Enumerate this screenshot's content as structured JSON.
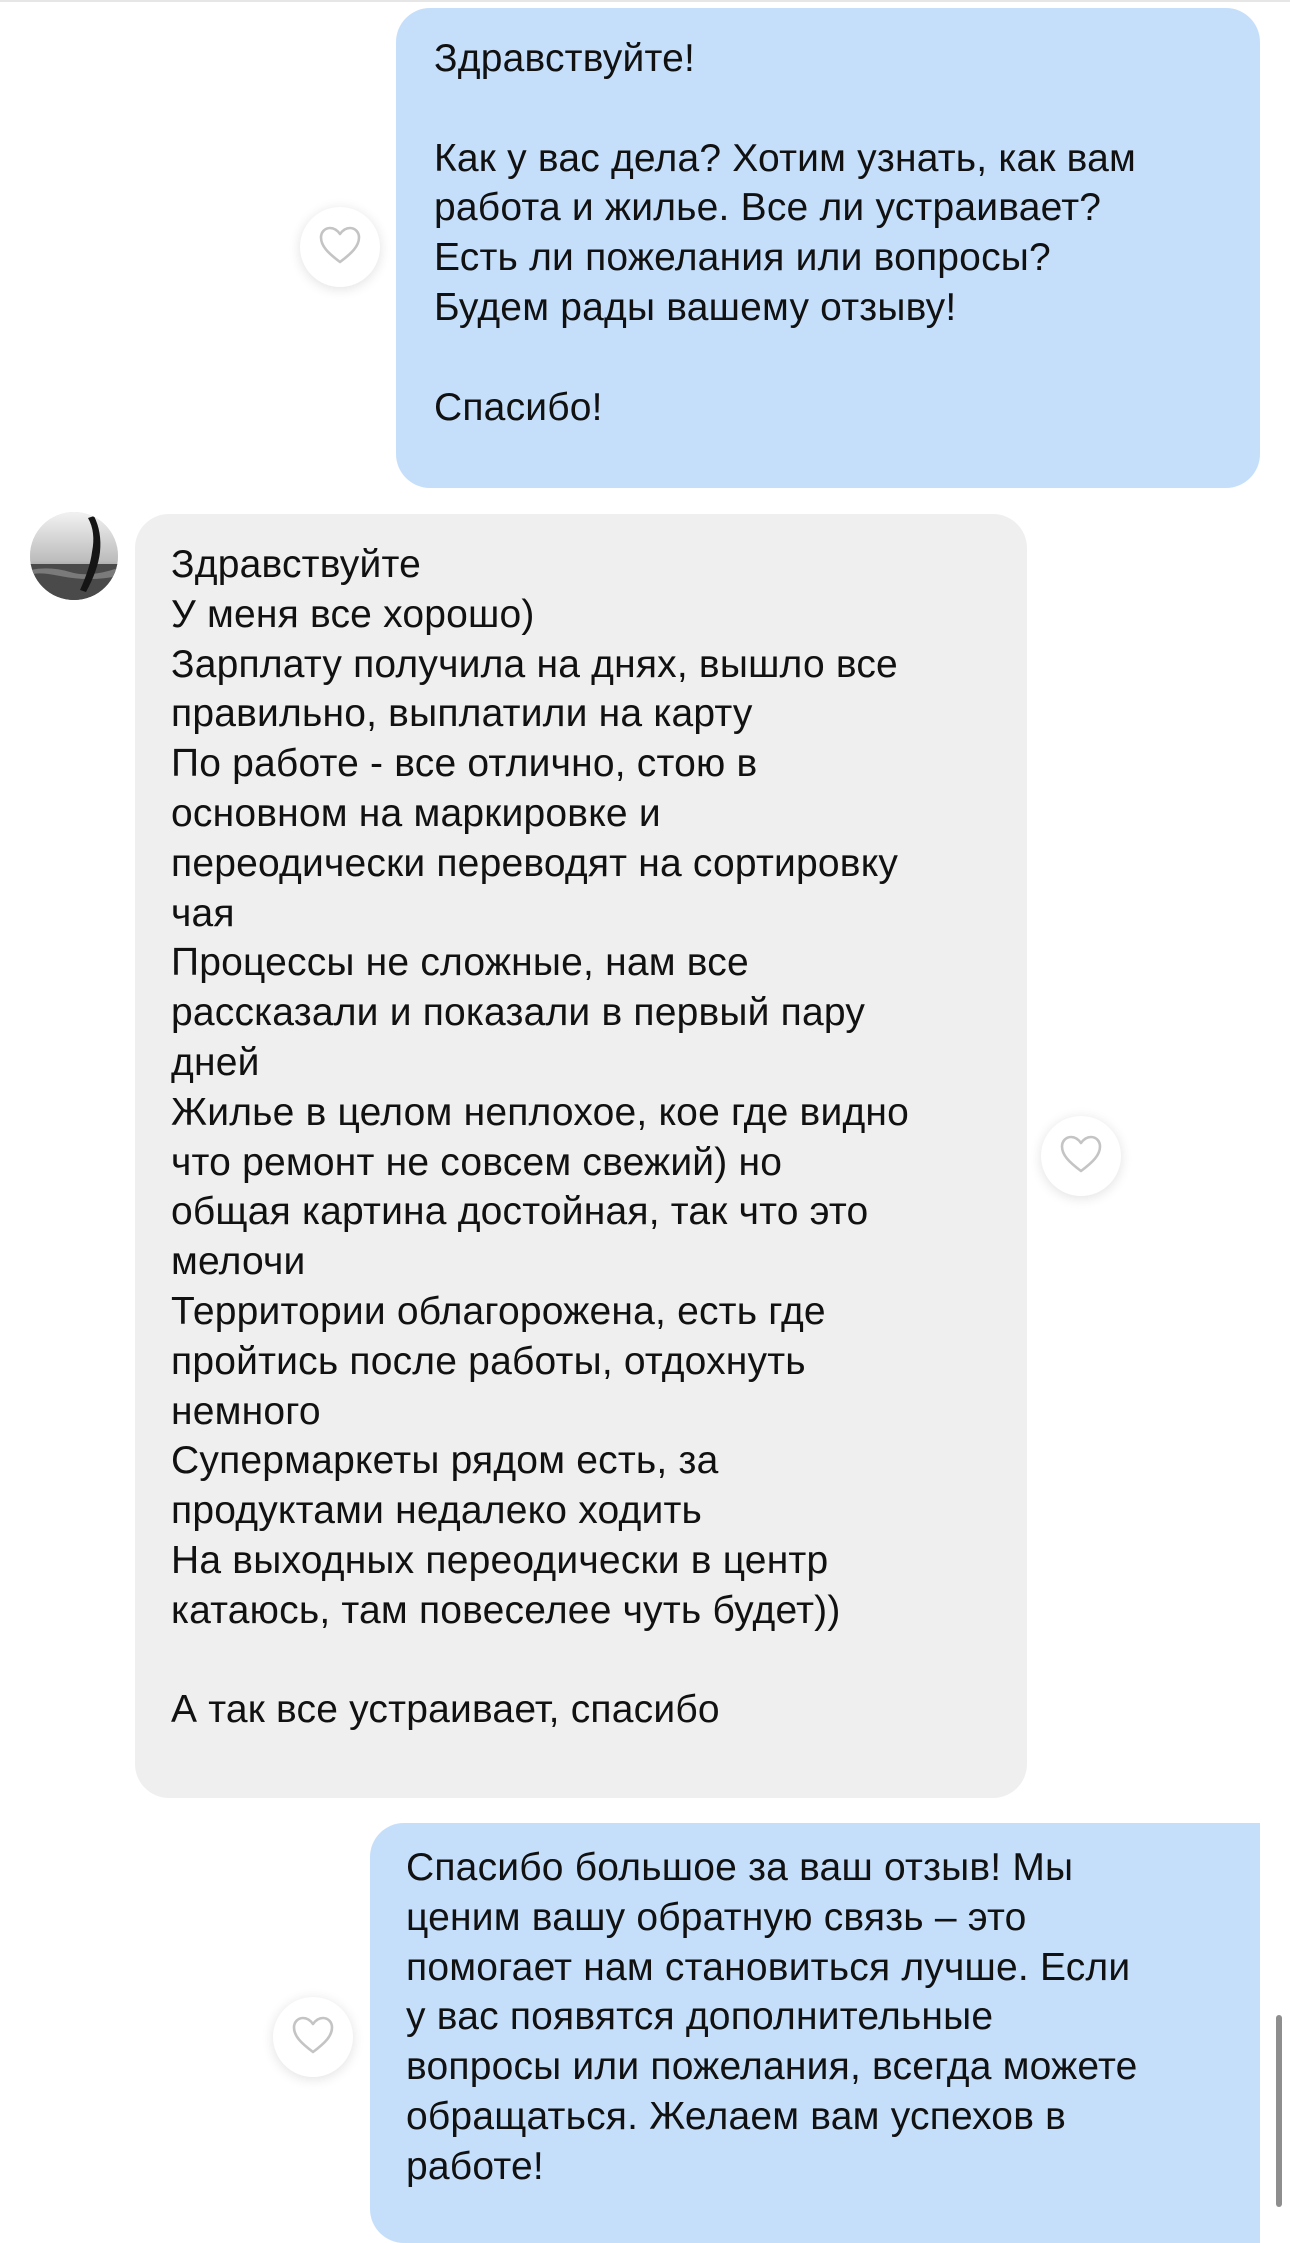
{
  "chat": {
    "messages": [
      {
        "direction": "outgoing",
        "lines": [
          "Здравствуйте!",
          "",
          "Как у вас дела? Хотим узнать, как вам",
          "работа и жилье. Все ли устраивает?",
          "Есть ли пожелания или вопросы?",
          "Будем рады вашему отзыву!",
          "",
          "Спасибо!"
        ]
      },
      {
        "direction": "incoming",
        "lines": [
          "Здравствуйте",
          "У меня все хорошо)",
          "Зарплату получила на днях, вышло все",
          "правильно, выплатили на карту",
          "По работе - все отлично, стою в",
          "основном на маркировке и",
          "переодически переводят на сортировку",
          "чая",
          "Процессы не сложные, нам все",
          "рассказали и показали в первый пару",
          "дней",
          "Жилье в целом неплохое, кое где видно",
          "что ремонт не совсем свежий) но",
          "общая картина достойная, так что это",
          "мелочи",
          "Территории облагорожена, есть где",
          "пройтись после работы, отдохнуть",
          "немного",
          "Супермаркеты рядом есть, за",
          "продуктами недалеко ходить",
          "На выходных переодически в центр",
          "катаюсь, там повеселее чуть будет))",
          "",
          "А так все устраивает, спасибо"
        ]
      },
      {
        "direction": "outgoing",
        "lines": [
          "Спасибо большое за ваш отзыв! Мы",
          "ценим вашу обратную связь – это",
          "помогает нам становиться лучше. Если",
          "у вас появятся дополнительные",
          "вопросы или пожелания, всегда можете",
          "обращаться. Желаем вам успехов в",
          "работе!"
        ]
      }
    ],
    "icons": {
      "like": "heart-outline-icon",
      "avatar": "user-avatar-photo"
    },
    "colors": {
      "outgoing_bubble": "#c5dffb",
      "incoming_bubble": "#efefef",
      "heart_stroke": "#c4c4c4",
      "background": "#ffffff"
    }
  }
}
